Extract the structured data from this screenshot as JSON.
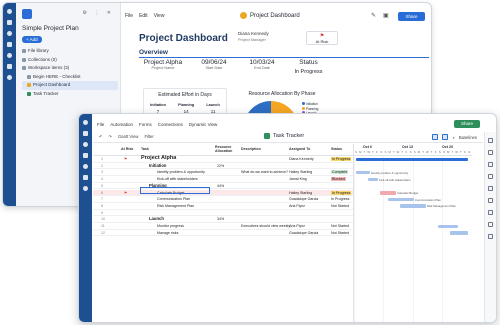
{
  "dashboard_window": {
    "sidebar": {
      "project_title": "Simple Project Plan",
      "add_label": "+ Add",
      "items": [
        {
          "label": "File library"
        },
        {
          "label": "Collections (0)"
        },
        {
          "label": "Workspace items (3)"
        },
        {
          "label": "Begin HERE - Checklist"
        },
        {
          "label": "Project Dashboard",
          "active": true
        },
        {
          "label": "Task Tracker"
        }
      ]
    },
    "menu": [
      "File",
      "Edit",
      "View"
    ],
    "title": "Project Dashboard",
    "share_label": "Share",
    "dashboard": {
      "heading": "Project Dashboard",
      "owner_name": "Diana Kennedy",
      "owner_role": "Project Manager",
      "overview_label": "Overview",
      "stats": [
        {
          "value": "Project Alpha",
          "label": "Project Name"
        },
        {
          "value": "09/06/24",
          "label": "Start Date"
        },
        {
          "value": "10/03/24",
          "label": "End Date"
        },
        {
          "value": "Status",
          "label": ""
        }
      ],
      "status_value": "In Progress",
      "at_risk_label": "At Risk",
      "effort": {
        "title": "Estimated Effort in Days",
        "columns": [
          {
            "label": "Initiation",
            "value": "7"
          },
          {
            "label": "Planning",
            "value": "14"
          },
          {
            "label": "Launch",
            "value": "11"
          }
        ]
      },
      "allocation": {
        "title": "Resource Allocation By Phase",
        "legend": [
          "Initiation",
          "Planning",
          "Launch"
        ],
        "colors": [
          "#2e6ec4",
          "#f5a623",
          "#8a5fc7"
        ],
        "center_label": "22%"
      }
    }
  },
  "tracker_window": {
    "menu": [
      "File",
      "Automation",
      "Forms",
      "Connections",
      "Dynamic View"
    ],
    "title": "Task Tracker",
    "share_label": "Share",
    "toolbar": [
      "Gantt View",
      "Filter"
    ],
    "baselines_label": "Baselines",
    "columns": [
      "At Risk",
      "Task",
      "Resource Allocation",
      "Description",
      "Assigned To",
      "Status"
    ],
    "rows": [
      {
        "num": "1",
        "task": "Project Alpha",
        "alloc": "",
        "desc": "",
        "assigned": "Diana Kennedy",
        "status": "In Progress",
        "type": "proj",
        "flag": true
      },
      {
        "num": "2",
        "task": "Initiation",
        "alloc": "22%",
        "desc": "",
        "assigned": "",
        "status": "",
        "type": "bold"
      },
      {
        "num": "3",
        "task": "Identify problem & opportunity",
        "alloc": "",
        "desc": "What do we want to achieve?",
        "assigned": "Hailey Starling",
        "status": "Complete",
        "type": "normal"
      },
      {
        "num": "4",
        "task": "Kick-off with stakeholders",
        "alloc": "",
        "desc": "",
        "assigned": "Jamal King",
        "status": "Blocked",
        "type": "normal"
      },
      {
        "num": "5",
        "task": "Planning",
        "alloc": "44%",
        "desc": "",
        "assigned": "",
        "status": "",
        "type": "bold"
      },
      {
        "num": "6",
        "task": "Calculate Budget",
        "alloc": "",
        "desc": "",
        "assigned": "Hailey Starling",
        "status": "In Progress",
        "type": "sel",
        "flag": true
      },
      {
        "num": "7",
        "task": "Communication Plan",
        "alloc": "",
        "desc": "",
        "assigned": "Guadalupe Garcia",
        "status": "In Progress",
        "type": "normal"
      },
      {
        "num": "8",
        "task": "Risk Management Plan",
        "alloc": "",
        "desc": "",
        "assigned": "Aria Flynz",
        "status": "Not Started",
        "type": "normal"
      },
      {
        "num": "9",
        "task": "",
        "alloc": "",
        "desc": "",
        "assigned": "",
        "status": "",
        "type": "normal"
      },
      {
        "num": "10",
        "task": "Launch",
        "alloc": "34%",
        "desc": "",
        "assigned": "",
        "status": "",
        "type": "bold"
      },
      {
        "num": "11",
        "task": "Monitor progress",
        "alloc": "",
        "desc": "Executives should view weekly",
        "assigned": "Aria Flynz",
        "status": "Not Started",
        "type": "normal"
      },
      {
        "num": "12",
        "task": "Manage risks",
        "alloc": "",
        "desc": "",
        "assigned": "Guadalupe Garcia",
        "status": "Not Started",
        "type": "normal"
      }
    ],
    "gantt": {
      "months": [
        "Oct 6",
        "Oct 13",
        "Oct 20"
      ],
      "bar_labels": [
        "Identify problem & opportunity",
        "Kick-off with stakeholders",
        "Calculate Budget",
        "Communication Plan",
        "Risk Management Plan"
      ]
    }
  }
}
